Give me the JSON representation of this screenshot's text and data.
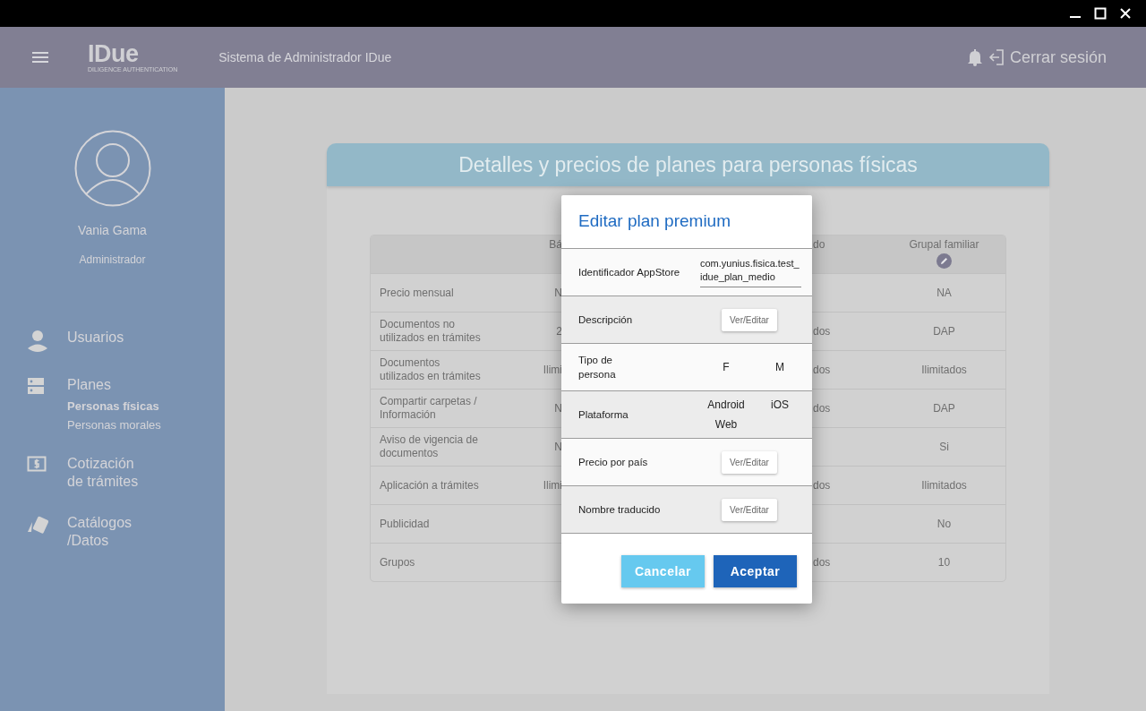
{
  "header": {
    "logo": "IDue",
    "logo_tagline": "DILIGENCE AUTHENTICATION",
    "title": "Sistema de Administrador IDue",
    "logout": "Cerrar sesión"
  },
  "sidebar": {
    "user": {
      "name": "Vania Gama",
      "role": "Administrador"
    },
    "items": [
      {
        "label": "Usuarios"
      },
      {
        "label": "Planes",
        "children": [
          {
            "label": "Personas físicas",
            "selected": true
          },
          {
            "label": "Personas morales",
            "selected": false
          }
        ]
      },
      {
        "label": "Cotización\nde trámites"
      },
      {
        "label": "Catálogos\n/Datos"
      }
    ]
  },
  "main": {
    "title": "Detalles y precios de planes para personas físicas",
    "table": {
      "header": {
        "column_2": "Bá",
        "column_4": "do",
        "column_5": "Grupal familiar"
      },
      "rows": [
        {
          "label": "Precio mensual",
          "column_2": "N",
          "column_5": "NA"
        },
        {
          "label": "Documentos no\nutilizados en trámites",
          "column_2": "2",
          "column_4": "dos",
          "column_5": "DAP"
        },
        {
          "label": "Documentos\nutilizados en trámites",
          "column_2": "Ilimi",
          "column_4": "dos",
          "column_5": "Ilimitados"
        },
        {
          "label": "Compartir carpetas /\nInformación",
          "column_2": "N",
          "column_4": "dos",
          "column_5": "DAP"
        },
        {
          "label": "Aviso de vigencia de\ndocumentos",
          "column_2": "N",
          "column_5": "Si"
        },
        {
          "label": "Aplicación a trámites",
          "column_2": "Ilimi",
          "column_4": "dos",
          "column_5": "Ilimitados"
        },
        {
          "label": "Publicidad",
          "column_5": "No"
        },
        {
          "label": "Grupos",
          "column_4": "dos",
          "column_5": "10"
        }
      ]
    }
  },
  "dialog": {
    "title": "Editar plan premium",
    "rows": [
      {
        "kind": "field",
        "label": "Identificador AppStore",
        "value": "com.yunius.fisica.test_idue_plan_medio"
      },
      {
        "kind": "button",
        "label": "Descripción",
        "button": "Ver/Editar"
      },
      {
        "kind": "options",
        "label": "Tipo de\npersona",
        "options": [
          "F",
          "M"
        ]
      },
      {
        "kind": "options",
        "label": "Plataforma",
        "options": [
          "Android",
          "iOS",
          "Web"
        ]
      },
      {
        "kind": "button",
        "label": "Precio por país",
        "button": "Ver/Editar"
      },
      {
        "kind": "button",
        "label": "Nombre traducido",
        "button": "Ver/Editar"
      }
    ],
    "buttons": [
      {
        "kind": "secondary",
        "label": "Cancelar"
      },
      {
        "kind": "primary",
        "label": "Aceptar"
      }
    ]
  }
}
